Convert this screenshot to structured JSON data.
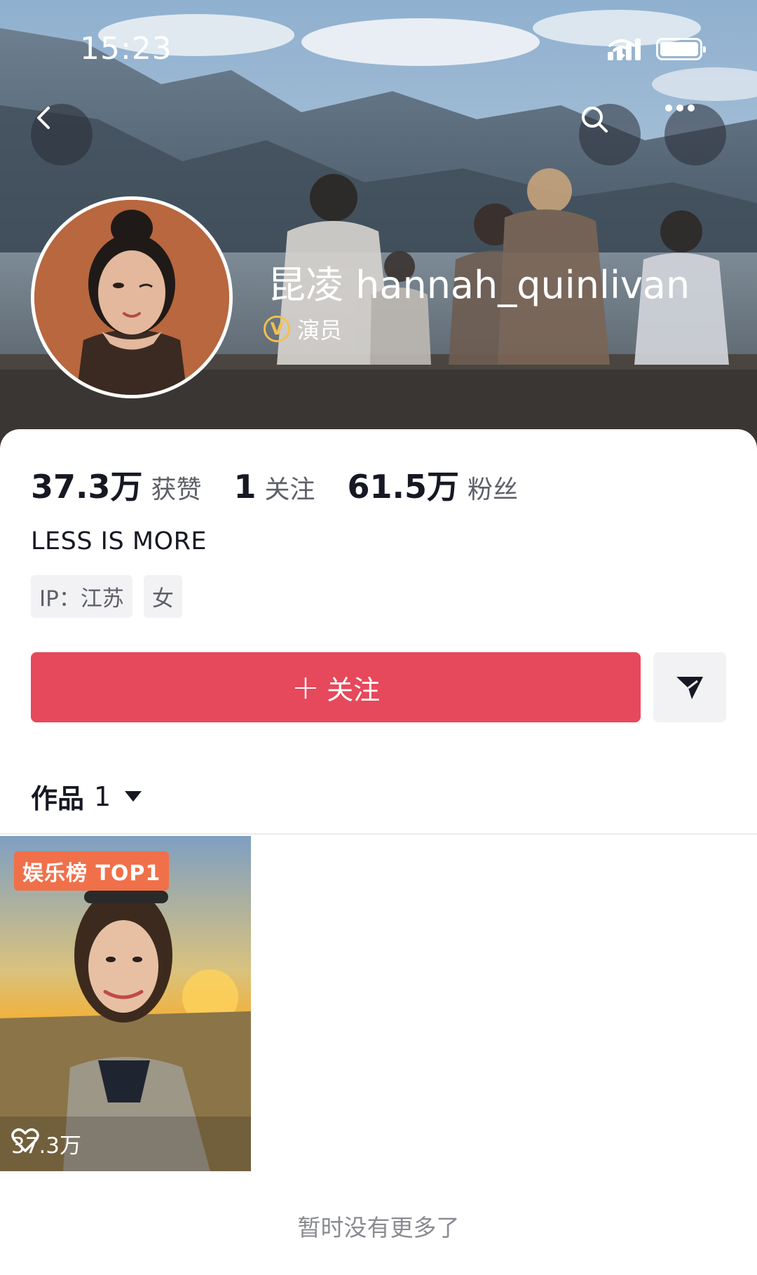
{
  "status_bar": {
    "time": "15:23"
  },
  "header": {
    "nickname": "昆凌 hannah_quinlivan",
    "verify_mark": "V",
    "verify_label": "演员",
    "icons": [
      "chevron-left-icon",
      "search-icon",
      "more-dots-icon"
    ]
  },
  "stats": [
    {
      "value": "37.3万",
      "label": "获赞"
    },
    {
      "value": "1",
      "label": "关注"
    },
    {
      "value": "61.5万",
      "label": "粉丝"
    }
  ],
  "bio": "LESS IS MORE",
  "tags": [
    "IP：江苏",
    "女"
  ],
  "actions": {
    "follow_plus": "+",
    "follow_label": "关注"
  },
  "works": {
    "tab_label": "作品",
    "count": "1",
    "items": [
      {
        "badge": "娱乐榜 TOP1",
        "likes": "37.3万"
      }
    ],
    "end_note": "暂时没有更多了"
  },
  "colors": {
    "accent": "#e6495b",
    "badge": "#f0704a",
    "verify": "#f2c14e"
  }
}
